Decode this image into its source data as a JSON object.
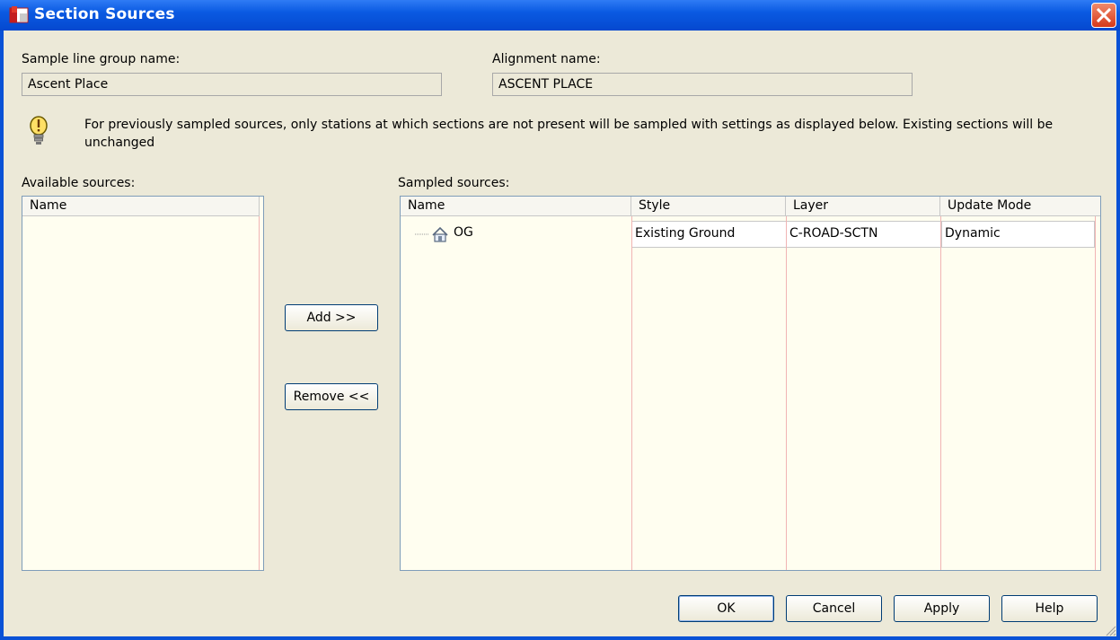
{
  "window": {
    "title": "Section Sources"
  },
  "sample_line_group": {
    "label": "Sample line group name:",
    "value": "Ascent Place"
  },
  "alignment": {
    "label": "Alignment name:",
    "value": "ASCENT PLACE"
  },
  "info": {
    "text": "For previously sampled sources, only stations at which sections are not present will be sampled with settings as displayed below. Existing sections will be unchanged"
  },
  "available": {
    "label": "Available sources:",
    "columns": [
      "Name"
    ]
  },
  "sampled": {
    "label": "Sampled sources:",
    "columns": [
      "Name",
      "Style",
      "Layer",
      "Update Mode"
    ],
    "rows": [
      {
        "name": "OG",
        "style": "Existing Ground",
        "layer": "C-ROAD-SCTN",
        "update_mode": "Dynamic"
      }
    ]
  },
  "buttons": {
    "add": "Add >>",
    "remove": "Remove <<",
    "ok": "OK",
    "cancel": "Cancel",
    "apply": "Apply",
    "help": "Help"
  },
  "icons": {
    "app": "civil3d-app-icon",
    "close": "close-icon",
    "info": "lightbulb-icon",
    "surface": "surface-icon"
  }
}
